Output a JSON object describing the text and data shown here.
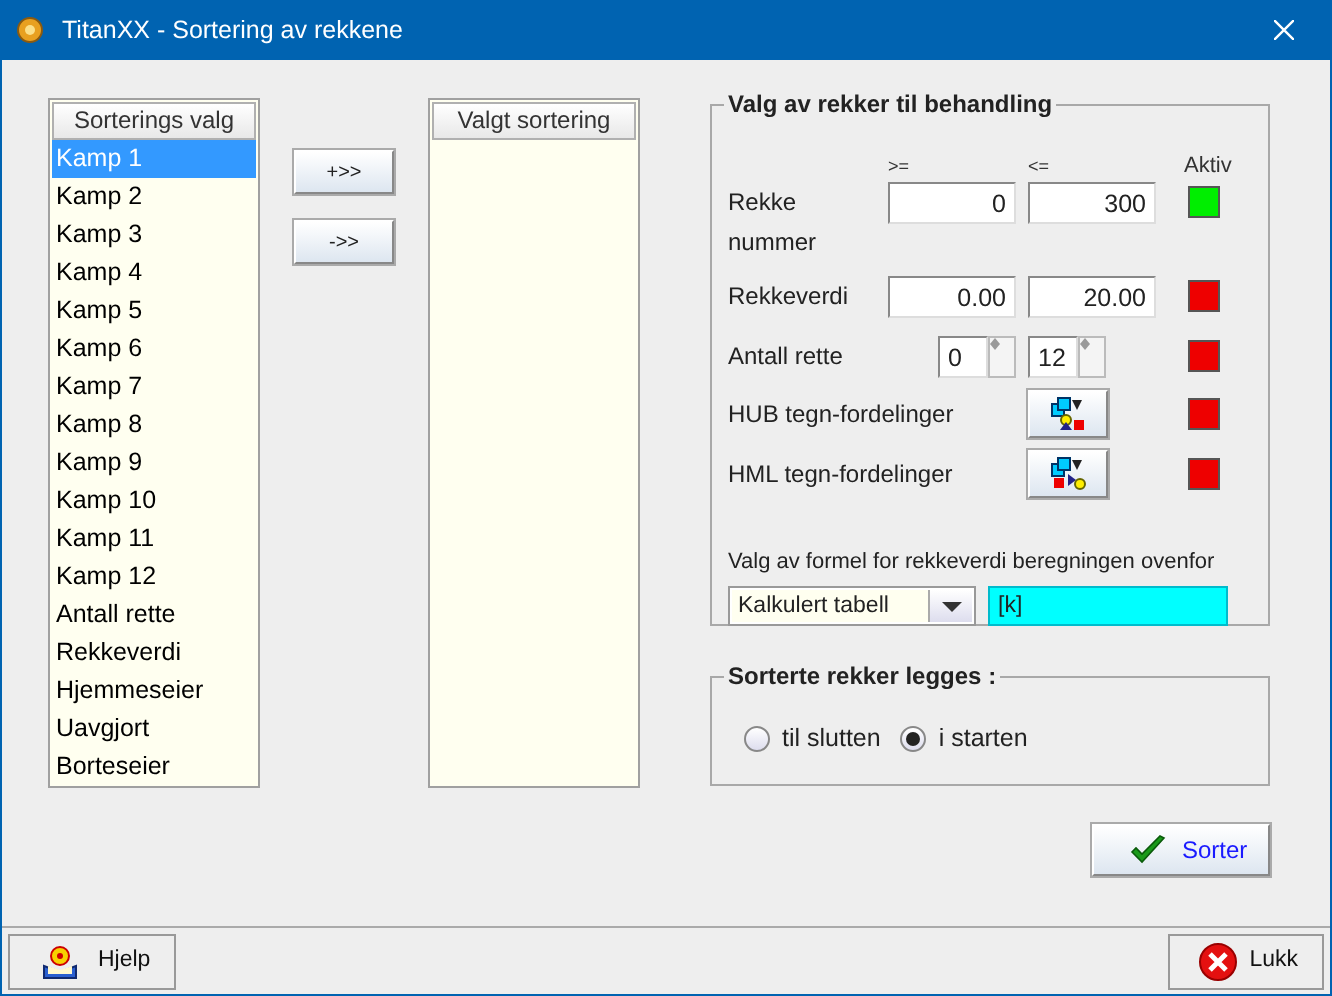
{
  "window": {
    "title": "TitanXX - Sortering av rekkene"
  },
  "available": {
    "header": "Sorterings valg",
    "items": [
      {
        "label": "Kamp 1",
        "selected": true
      },
      {
        "label": "Kamp 2",
        "selected": false
      },
      {
        "label": "Kamp 3",
        "selected": false
      },
      {
        "label": "Kamp 4",
        "selected": false
      },
      {
        "label": "Kamp 5",
        "selected": false
      },
      {
        "label": "Kamp 6",
        "selected": false
      },
      {
        "label": "Kamp 7",
        "selected": false
      },
      {
        "label": "Kamp 8",
        "selected": false
      },
      {
        "label": "Kamp 9",
        "selected": false
      },
      {
        "label": "Kamp 10",
        "selected": false
      },
      {
        "label": "Kamp 11",
        "selected": false
      },
      {
        "label": "Kamp 12",
        "selected": false
      },
      {
        "label": "Antall rette",
        "selected": false
      },
      {
        "label": "Rekkeverdi",
        "selected": false
      },
      {
        "label": "Hjemmeseier",
        "selected": false
      },
      {
        "label": "Uavgjort",
        "selected": false
      },
      {
        "label": "Borteseier",
        "selected": false
      }
    ]
  },
  "move_buttons": [
    "+>>",
    "->>"
  ],
  "chosen": {
    "header": "Valgt sortering"
  },
  "filter": {
    "title": "Valg av rekker til behandling",
    "col_from": ">=",
    "col_to": "<=",
    "col_active": "Aktiv",
    "rows": [
      {
        "kind": "range",
        "label": "Rekke nummer",
        "from": "0",
        "to": "300",
        "active": true
      },
      {
        "kind": "range",
        "label": "Rekkeverdi",
        "from": "0.00",
        "to": "20.00",
        "active": false
      },
      {
        "kind": "spin",
        "label": "Antall rette",
        "from": "0",
        "to": "12",
        "active": false
      },
      {
        "kind": "hub",
        "label": "HUB tegn-fordelinger",
        "active": false
      },
      {
        "kind": "hml",
        "label": "HML tegn-fordelinger",
        "active": false
      }
    ],
    "formula_label": "Valg av formel for rekkeverdi beregningen ovenfor",
    "formula_select": "Kalkulert tabell",
    "formula_value": "[k]"
  },
  "placement": {
    "title": "Sorterte rekker legges :",
    "options": [
      {
        "label": "til slutten",
        "selected": false
      },
      {
        "label": "i starten",
        "selected": true
      }
    ]
  },
  "sort_button": "Sorter",
  "help_button": "Hjelp",
  "close_button": "Lukk"
}
